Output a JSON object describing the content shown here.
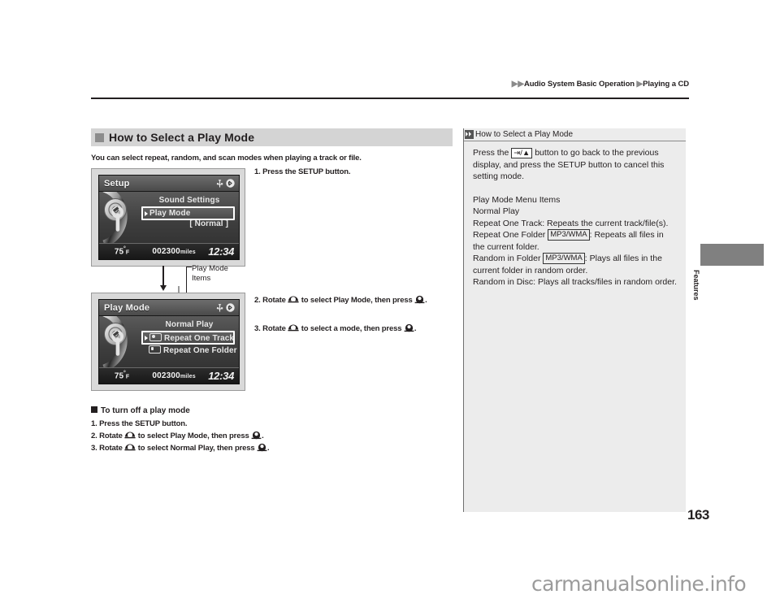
{
  "header": {
    "breadcrumb_1": "Audio System Basic Operation",
    "breadcrumb_2": "Playing a CD"
  },
  "section": {
    "title": "How to Select a Play Mode",
    "intro": "You can select repeat, random, and scan modes when playing a track or file."
  },
  "screens": {
    "setup": {
      "title": "Setup",
      "heading": "Sound Settings",
      "row_label": "Play Mode",
      "row_value": "[ Normal ]",
      "temp": "75",
      "temp_unit": "F",
      "odometer": "002300",
      "odometer_unit": "miles",
      "clock": "12:34"
    },
    "playmode": {
      "title": "Play Mode",
      "item_1": "Normal Play",
      "item_2": "Repeat One Track",
      "item_3": "Repeat One Folder",
      "temp": "75",
      "temp_unit": "F",
      "odometer": "002300",
      "odometer_unit": "miles",
      "clock": "12:34"
    }
  },
  "callout": {
    "line_1": "Play Mode",
    "line_2": "Items"
  },
  "steps": {
    "step1": "1. Press the SETUP button.",
    "step2_a": "2. Rotate",
    "step2_b": "to select Play Mode, then press",
    "step2_c": ".",
    "step3_a": "3. Rotate",
    "step3_b": "to select a mode, then press",
    "step3_c": "."
  },
  "turn_off": {
    "heading": "To turn off a play mode",
    "step1": "1. Press the SETUP button.",
    "step2_a": "2. Rotate",
    "step2_b": "to select Play Mode, then press",
    "step2_c": ".",
    "step3_a": "3. Rotate",
    "step3_b": "to select Normal Play, then press",
    "step3_c": "."
  },
  "info_panel": {
    "title": "How to Select a Play Mode",
    "para1_a": "Press the",
    "para1_btn": "/",
    "para1_b": "button to go back to the previous display, and press the SETUP button to cancel this setting mode.",
    "menu_items_heading": "Play Mode Menu Items",
    "item_normal": "Normal Play",
    "item_repeat_track": "Repeat One Track: Repeats the current track/file(s).",
    "item_repeat_folder_a": "Repeat One Folder",
    "item_repeat_folder_tag": "MP3/WMA",
    "item_repeat_folder_b": ": Repeats all files in the current folder.",
    "item_random_folder_a": "Random in Folder",
    "item_random_folder_tag": "MP3/WMA",
    "item_random_folder_b": ": Plays all files in the current folder in random order.",
    "item_random_disc": "Random in Disc: Plays all tracks/files in random order."
  },
  "side_tab": {
    "label": "Features"
  },
  "page_number": "163",
  "watermark": "carmanualsonline.info",
  "icons": {
    "usb": "usb-icon",
    "bluetooth": "bluetooth-icon",
    "knob": "rotary-knob-icon",
    "enter": "enter-knob-icon",
    "back": "back-button-icon"
  },
  "colors": {
    "section_bar": "#d4d4d4",
    "panel_bg": "#ececec",
    "tab": "#808080",
    "ink": "#231f20"
  }
}
